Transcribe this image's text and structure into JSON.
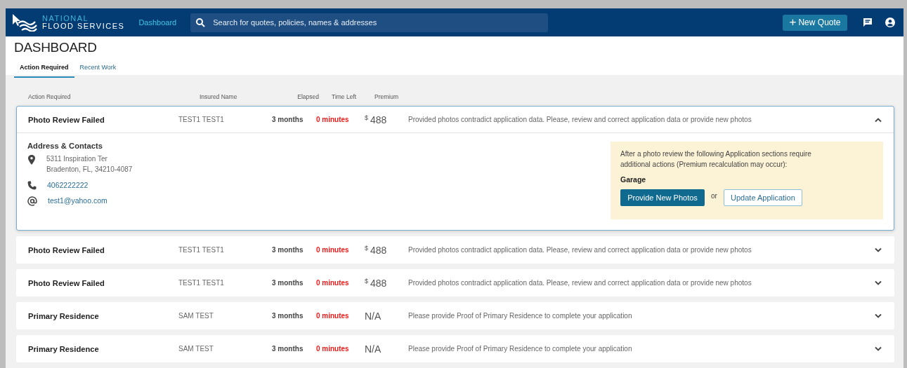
{
  "header": {
    "logo": {
      "line_1": "NATIONAL",
      "line_2": "FLOOD SERVICES"
    },
    "nav_link": "Dashboard",
    "search": {
      "placeholder": "Search for quotes, policies, names & addresses"
    },
    "new_quote_button": {
      "icon": "+",
      "label": "New Quote"
    }
  },
  "page_title": "DASHBOARD",
  "tabs": [
    {
      "label": "Action Required",
      "selected": true
    },
    {
      "label": "Recent Work",
      "selected": false
    }
  ],
  "table": {
    "columns": [
      "Action Required",
      "Insured Name",
      "Elapsed",
      "Time Left",
      "Premium"
    ],
    "rows": [
      {
        "action": "Photo Review Failed",
        "insured_name": "TEST1 TEST1",
        "elapsed": "3 months",
        "time_left": "0 minutes",
        "premium": {
          "currency": "$",
          "amount": "488"
        },
        "message": "Provided photos contradict application data. Please, review and correct application data or provide new photos",
        "expanded": true,
        "details": {
          "title": "Address & Contacts",
          "address": [
            "5311 Inspiration Ter",
            "Bradenton, FL, 34210-4087"
          ],
          "phone": "4062222222",
          "email": "test1@yahoo.com",
          "notice": {
            "text": "After a photo review the following Application sections require additional actions (Premium recalculation may occur):",
            "section": "Garage",
            "primary_button": "Provide New Photos",
            "separator": "or",
            "secondary_button": "Update Application"
          }
        }
      },
      {
        "action": "Photo Review Failed",
        "insured_name": "TEST1 TEST1",
        "elapsed": "3 months",
        "time_left": "0 minutes",
        "premium": {
          "currency": "$",
          "amount": "488"
        },
        "message": "Provided photos contradict application data. Please, review and correct application data or provide new photos",
        "expanded": false
      },
      {
        "action": "Photo Review Failed",
        "insured_name": "TEST1 TEST1",
        "elapsed": "3 months",
        "time_left": "0 minutes",
        "premium": {
          "currency": "$",
          "amount": "488"
        },
        "message": "Provided photos contradict application data. Please, review and correct application data or provide new photos",
        "expanded": false
      },
      {
        "action": "Primary Residence",
        "insured_name": "SAM TEST",
        "elapsed": "3 months",
        "time_left": "0 minutes",
        "premium": {
          "amount": "N/A"
        },
        "message": "Please provide Proof of Primary Residence to complete your application",
        "expanded": false
      },
      {
        "action": "Primary Residence",
        "insured_name": "SAM TEST",
        "elapsed": "3 months",
        "time_left": "0 minutes",
        "premium": {
          "amount": "N/A"
        },
        "message": "Please provide Proof of Primary Residence to complete your application",
        "expanded": false
      }
    ]
  }
}
